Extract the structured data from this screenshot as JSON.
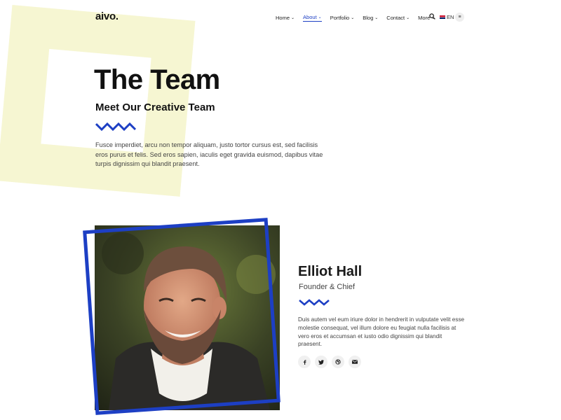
{
  "brand": {
    "logo": "aivo."
  },
  "nav": {
    "items": [
      {
        "label": "Home"
      },
      {
        "label": "About",
        "active": true
      },
      {
        "label": "Portfolio"
      },
      {
        "label": "Blog"
      },
      {
        "label": "Contact"
      },
      {
        "label": "More"
      }
    ],
    "language": "EN",
    "icons": [
      "search-icon",
      "flag-icon",
      "menu-icon"
    ]
  },
  "hero": {
    "title": "The Team",
    "subtitle": "Meet Our Creative Team",
    "text": "Fusce imperdiet, arcu non tempor aliquam, justo tortor cursus est, sed facilisis eros purus et felis. Sed eros sapien, iaculis eget gravida euismod, dapibus vitae turpis dignissim qui blandit praesent."
  },
  "member": {
    "name": "Elliot Hall",
    "role": "Founder & Chief",
    "bio": "Duis autem vel eum iriure dolor in hendrerit in vulputate velit esse molestie consequat, vel illum dolore eu feugiat nulla facilisis at vero eros et accumsan et iusto odio dignissim qui blandit praesent.",
    "socials": [
      "facebook-icon",
      "twitter-icon",
      "dribbble-icon",
      "email-icon"
    ]
  },
  "colors": {
    "accent": "#1d3fc4",
    "deco_yellow": "#f6f6d2",
    "text": "#1a1a1a"
  }
}
